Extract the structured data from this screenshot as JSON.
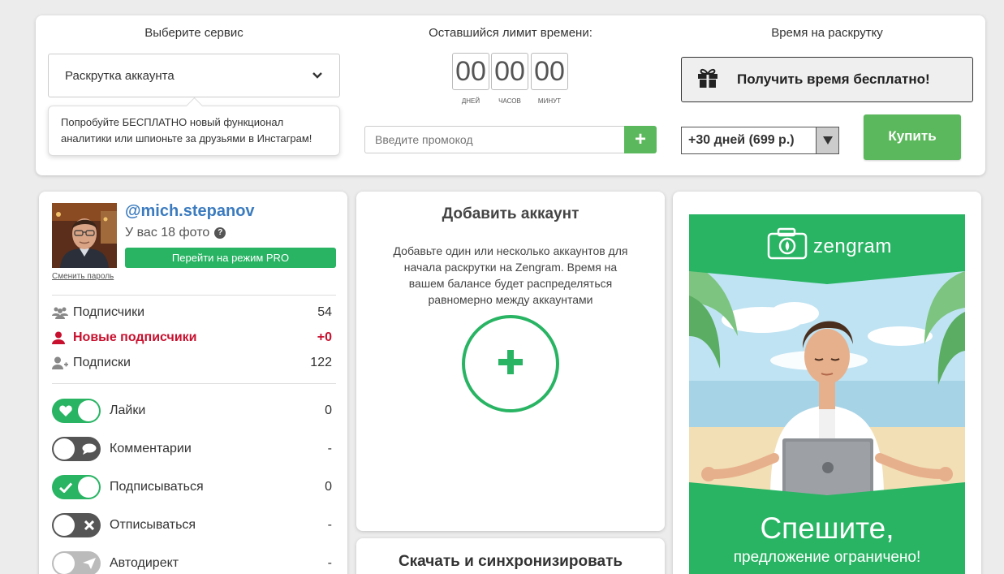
{
  "service": {
    "title": "Выберите сервис",
    "selected": "Раскрутка аккаунта",
    "tooltip": "Попробуйте БЕСПЛАТНО новый функционал аналитики или шпионьте за друзьями в Инстаграм!"
  },
  "timer": {
    "title": "Оставшийся лимит времени:",
    "days": "00",
    "hours": "00",
    "minutes": "00",
    "days_label": "ДНЕЙ",
    "hours_label": "ЧАСОВ",
    "minutes_label": "МИНУТ",
    "promo_placeholder": "Введите промокод",
    "promo_button": "+"
  },
  "purchase": {
    "title": "Время на раскрутку",
    "free_button": "Получить время бесплатно!",
    "period": "+30 дней (699 р.)",
    "buy_button": "Купить"
  },
  "account": {
    "username": "@mich.stepanov",
    "photos": "У вас 18 фото",
    "pro_button": "Перейти на режим PRO",
    "change_password": "Сменить пароль",
    "stats": [
      {
        "label": "Подписчики",
        "value": "54",
        "icon": "users-icon"
      },
      {
        "label": "Новые подписчики",
        "value": "+0",
        "icon": "new-user-icon"
      },
      {
        "label": "Подписки",
        "value": "122",
        "icon": "add-user-icon"
      }
    ],
    "actions": [
      {
        "label": "Лайки",
        "count": "0",
        "on": true,
        "icon": "heart-icon"
      },
      {
        "label": "Комментарии",
        "count": "-",
        "on": false,
        "icon": "comment-icon"
      },
      {
        "label": "Подписываться",
        "count": "0",
        "on": true,
        "icon": "check-icon"
      },
      {
        "label": "Отписываться",
        "count": "-",
        "on": false,
        "icon": "cross-icon"
      },
      {
        "label": "Автодирект",
        "count": "-",
        "on": false,
        "icon": "send-icon"
      }
    ]
  },
  "add_account": {
    "title": "Добавить аккаунт",
    "description": "Добавьте один или несколько аккаунтов для начала раскрутки на Zengram. Время на вашем балансе будет распределяться равномерно между аккаунтами"
  },
  "sync": {
    "title": "Скачать и синхронизировать"
  },
  "banner": {
    "brand": "zengram",
    "headline": "Спешите,",
    "subline": "предложение ограничено!"
  },
  "colors": {
    "green": "#28b463",
    "button_green": "#5cb85c",
    "link_blue": "#3b7bbf",
    "alert_red": "#c8102e"
  }
}
